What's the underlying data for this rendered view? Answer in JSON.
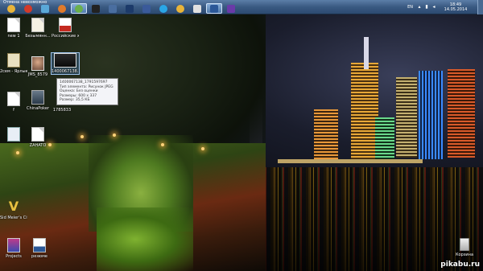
{
  "taskbar": {
    "window_title": "Отмена невозможно",
    "apps": [
      {
        "icon": "chrome-icon",
        "color": "#e8b43a",
        "active": false
      },
      {
        "icon": "poker-icon",
        "color": "#d43a2a",
        "active": false
      },
      {
        "icon": "network-icon",
        "color": "#5aa8d8",
        "active": false
      },
      {
        "icon": "firefox-icon",
        "color": "#e07a2a",
        "active": false
      },
      {
        "icon": "utorrent-icon",
        "color": "#6ab04c",
        "active": true
      },
      {
        "icon": "terminal-icon",
        "color": "#222222",
        "active": false
      },
      {
        "icon": "virtualbox-icon",
        "color": "#4a6ea0",
        "active": false
      },
      {
        "icon": "photoshop-icon",
        "color": "#1c3a6a",
        "active": false
      },
      {
        "icon": "floppy-icon",
        "color": "#3a5a9a",
        "active": false
      },
      {
        "icon": "skype-icon",
        "color": "#2aa6e6",
        "active": false
      },
      {
        "icon": "chrome2-icon",
        "color": "#e8b43a",
        "active": false
      },
      {
        "icon": "paint-icon",
        "color": "#e0e0e0",
        "active": false
      },
      {
        "icon": "word-icon",
        "color": "#2b5797",
        "active": true
      },
      {
        "icon": "visual-studio-icon",
        "color": "#6a3aa8",
        "active": false
      }
    ],
    "language": "EN",
    "time": "18:49",
    "date": "14.05.2014"
  },
  "desktop": {
    "icons": [
      {
        "label": "new 1"
      },
      {
        "label": "Безымянн..."
      },
      {
        "label": "Российские железные..."
      },
      {
        "label": "2сем - Ярлык"
      },
      {
        "label": "JMS_8579"
      },
      {
        "label": "1400067138..."
      },
      {
        "label": "f"
      },
      {
        "label": "ChinaPoker"
      },
      {
        "label": "1785833"
      },
      {
        "label": ""
      },
      {
        "label": "ZAHATO"
      },
      {
        "label": "Sid Meier's Civilization..."
      },
      {
        "label": "Projects"
      },
      {
        "label": "резюме"
      },
      {
        "label": "Корзина"
      }
    ],
    "tooltip": [
      "1400067138_1791597697",
      "Тип элемента: Рисунок JPEG",
      "Оценка: Без оценки",
      "Размеры: 600 x 337",
      "Размер: 35,5 КБ"
    ]
  },
  "watermark": "pikabu.ru"
}
